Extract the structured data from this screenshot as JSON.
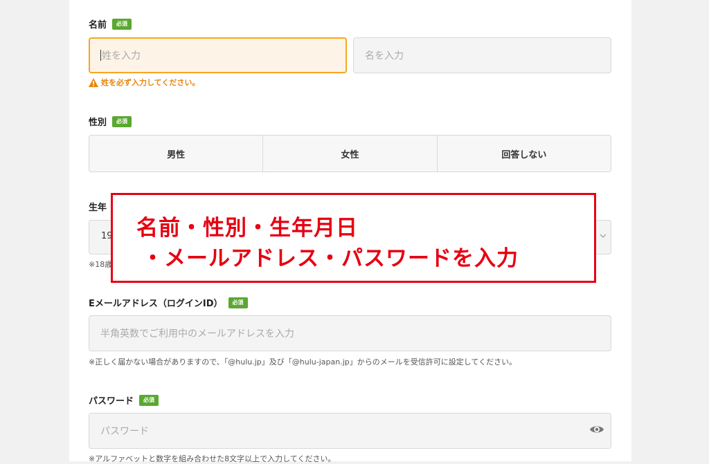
{
  "required_badge": "必須",
  "name": {
    "label": "名前",
    "last_placeholder": "姓を入力",
    "first_placeholder": "名を入力",
    "error": "姓を必ず入力してください。"
  },
  "gender": {
    "label": "性別",
    "options": [
      "男性",
      "女性",
      "回答しない"
    ]
  },
  "dob": {
    "label": "生年",
    "value": "19",
    "note": "※18歳"
  },
  "email": {
    "label": "Eメールアドレス（ログインID）",
    "placeholder": "半角英数でご利用中のメールアドレスを入力",
    "note": "※正しく届かない場合がありますので、「@hulu.jp」及び「@hulu-japan.jp」からのメールを受信許可に設定してください。"
  },
  "password": {
    "label": "パスワード",
    "placeholder": "パスワード",
    "note": "※アルファベットと数字を組み合わせた8文字以上で入力してください。"
  },
  "annotation": {
    "line1": "名前・性別・生年月日",
    "line2": "・メールアドレス・パスワードを入力",
    "color": "#e60012"
  },
  "colors": {
    "required_badge": "#5aa830",
    "error": "#e8860e",
    "error_border": "#f5a623"
  }
}
